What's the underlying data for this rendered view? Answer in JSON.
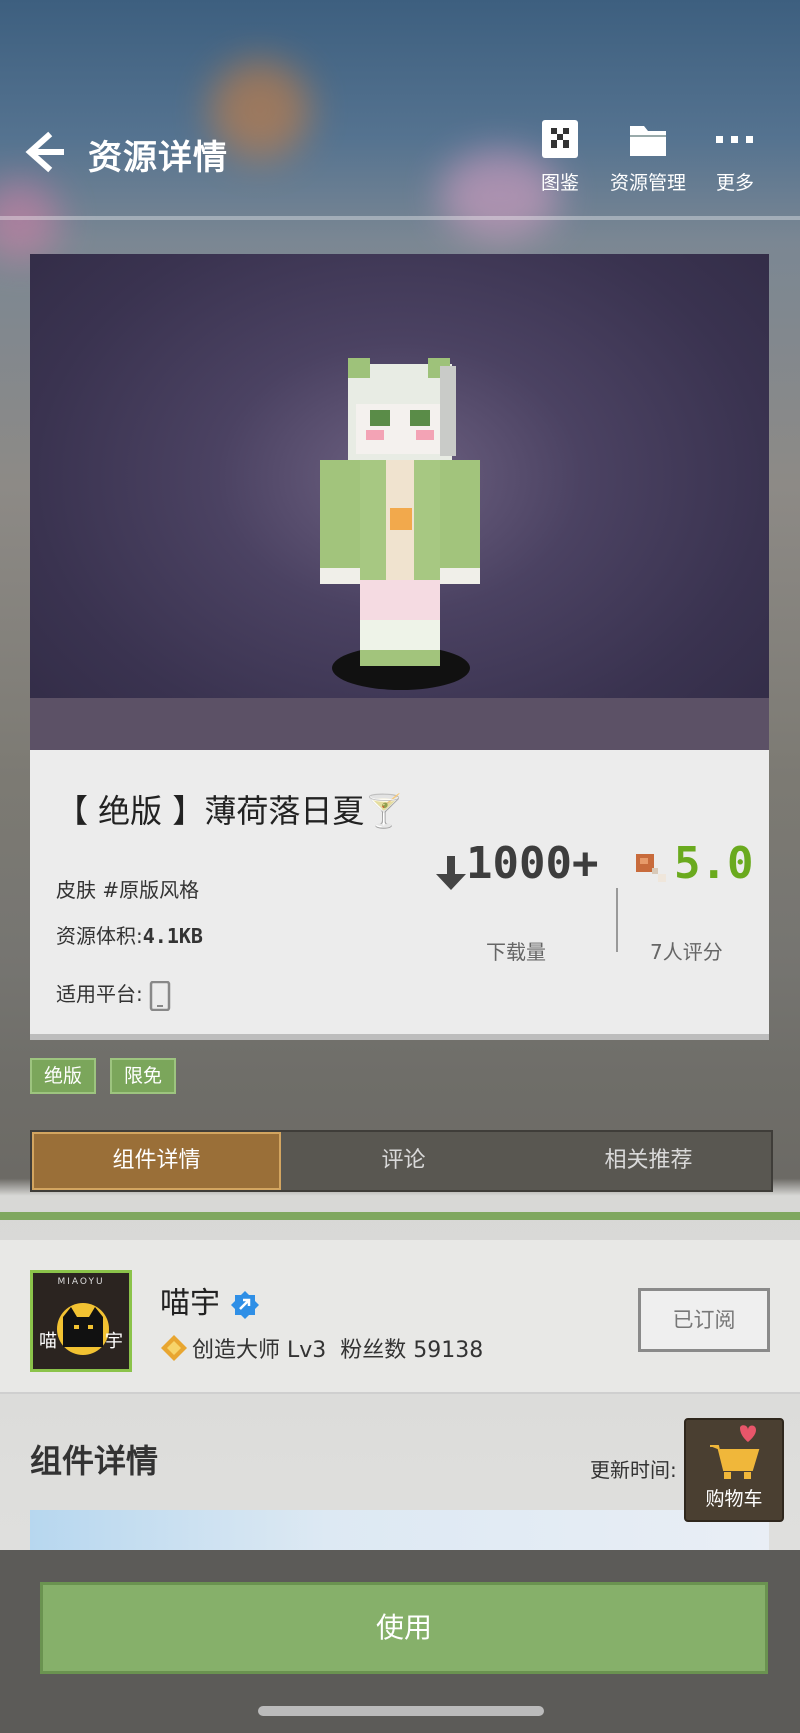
{
  "header": {
    "title": "资源详情",
    "buttons": [
      {
        "label": "图鉴",
        "icon": "encyclopedia-icon"
      },
      {
        "label": "资源管理",
        "icon": "folder-icon"
      },
      {
        "label": "更多",
        "icon": "more-dots-icon"
      }
    ]
  },
  "resource": {
    "name": "【 绝版 】薄荷落日夏🍸",
    "category": "皮肤  #原版风格",
    "size_label": "资源体积:",
    "size_value": "4.1KB",
    "platform_label": "适用平台:",
    "downloads": "1000+",
    "downloads_label": "下载量",
    "rating": "5.0",
    "rating_label": "7人评分"
  },
  "tags": [
    "绝版",
    "限免"
  ],
  "tabs": [
    {
      "label": "组件详情",
      "active": true
    },
    {
      "label": "评论",
      "active": false
    },
    {
      "label": "相关推荐",
      "active": false
    }
  ],
  "author": {
    "name": "喵宇",
    "level": "创造大师 Lv3",
    "fans": "粉丝数 59138",
    "subscribe_label": "已订阅",
    "avatar_text": "喵",
    "avatar_text2": "宇",
    "avatar_brand": "MIAOYU"
  },
  "details": {
    "title": "组件详情",
    "update_label": "更新时间:"
  },
  "cart": {
    "label": "购物车"
  },
  "use_button": "使用",
  "colors": {
    "accent_green": "#86b06a",
    "tab_active": "#9a6f38",
    "rating_green": "#6aaa1e"
  }
}
